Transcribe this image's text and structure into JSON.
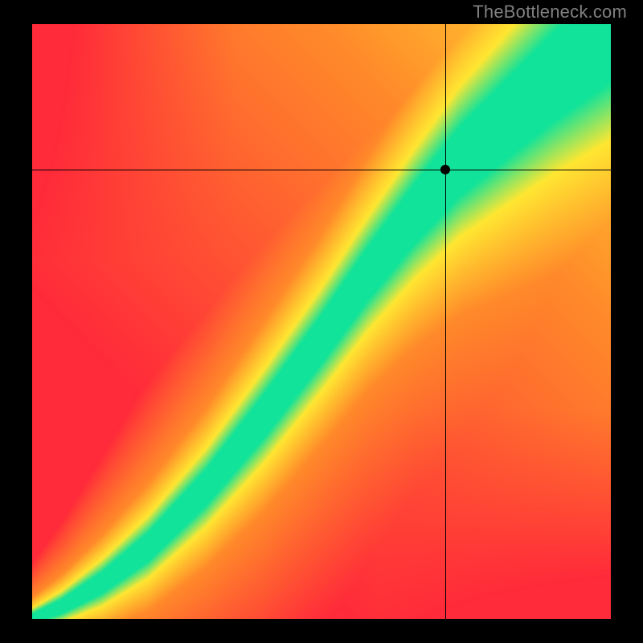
{
  "attribution": "TheBottleneck.com",
  "chart_data": {
    "type": "heatmap",
    "title": "",
    "xlabel": "",
    "ylabel": "",
    "xlim": [
      0,
      1
    ],
    "ylim": [
      0,
      1
    ],
    "grid": false,
    "legend": false,
    "crosshair": {
      "x": 0.714,
      "y": 0.755
    },
    "marker": {
      "x": 0.714,
      "y": 0.755
    },
    "color_stops": {
      "red": "#ff2a3a",
      "orange": "#ff8a2a",
      "yellow": "#ffe732",
      "green": "#12e39a"
    },
    "ridge": [
      {
        "x": 0.0,
        "y": 0.0,
        "half_width": 0.008
      },
      {
        "x": 0.05,
        "y": 0.02,
        "half_width": 0.012
      },
      {
        "x": 0.12,
        "y": 0.06,
        "half_width": 0.018
      },
      {
        "x": 0.2,
        "y": 0.12,
        "half_width": 0.024
      },
      {
        "x": 0.3,
        "y": 0.22,
        "half_width": 0.03
      },
      {
        "x": 0.4,
        "y": 0.34,
        "half_width": 0.036
      },
      {
        "x": 0.5,
        "y": 0.47,
        "half_width": 0.04
      },
      {
        "x": 0.58,
        "y": 0.58,
        "half_width": 0.044
      },
      {
        "x": 0.66,
        "y": 0.68,
        "half_width": 0.05
      },
      {
        "x": 0.74,
        "y": 0.77,
        "half_width": 0.058
      },
      {
        "x": 0.82,
        "y": 0.84,
        "half_width": 0.066
      },
      {
        "x": 0.9,
        "y": 0.91,
        "half_width": 0.074
      },
      {
        "x": 1.0,
        "y": 0.985,
        "half_width": 0.082
      }
    ],
    "corner_colors": {
      "top_left": "#ff2a3a",
      "top_right": "#ffe732",
      "bottom_left": "#ff5a32",
      "bottom_right": "#ff2a3a"
    }
  }
}
